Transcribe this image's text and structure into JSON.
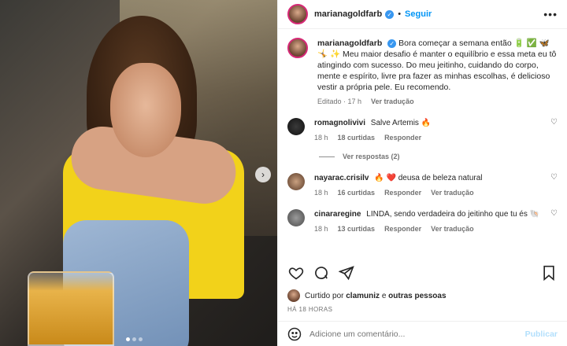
{
  "post": {
    "username": "marianagoldfarb",
    "follow_label": "Seguir",
    "more_label": "•••",
    "separator": "•"
  },
  "caption": {
    "username": "marianagoldfarb",
    "text": "Bora começar a semana então 🔋 ✅ 🦋 🤸 ✨ Meu maior desafio é manter o equilíbrio e essa meta eu tô atingindo com sucesso. Do meu jeitinho, cuidando do corpo, mente e espírito, livre pra fazer as minhas escolhas, é delicioso vestir a própria pele. Eu recomendo.",
    "edited": "Editado · 17 h",
    "translate": "Ver tradução"
  },
  "comments": [
    {
      "username": "romagnolivivi",
      "text": "Salve Artemis 🔥",
      "time": "18 h",
      "likes": "18 curtidas",
      "reply": "Responder",
      "view_replies": "Ver respostas (2)"
    },
    {
      "username": "nayarac.crisilv",
      "text": "🔥 ❤️ deusa de beleza natural",
      "time": "18 h",
      "likes": "16 curtidas",
      "reply": "Responder",
      "translate": "Ver tradução"
    },
    {
      "username": "cinararegine",
      "text": "LINDA, sendo verdadeira do jeitinho que tu és 🐚",
      "time": "18 h",
      "likes": "13 curtidas",
      "reply": "Responder",
      "translate": "Ver tradução"
    }
  ],
  "likes": {
    "prefix": "Curtido por",
    "user": "clamuniz",
    "connector": "e",
    "others": "outras pessoas"
  },
  "timestamp": "HÁ 18 HORAS",
  "add_comment": {
    "placeholder": "Adicione um comentário...",
    "post_label": "Publicar"
  },
  "carousel": {
    "next_icon": "›",
    "count": 3,
    "active_index": 0
  },
  "colors": {
    "accent": "#0095f6",
    "verified": "#3897f0",
    "muted": "#737373"
  }
}
